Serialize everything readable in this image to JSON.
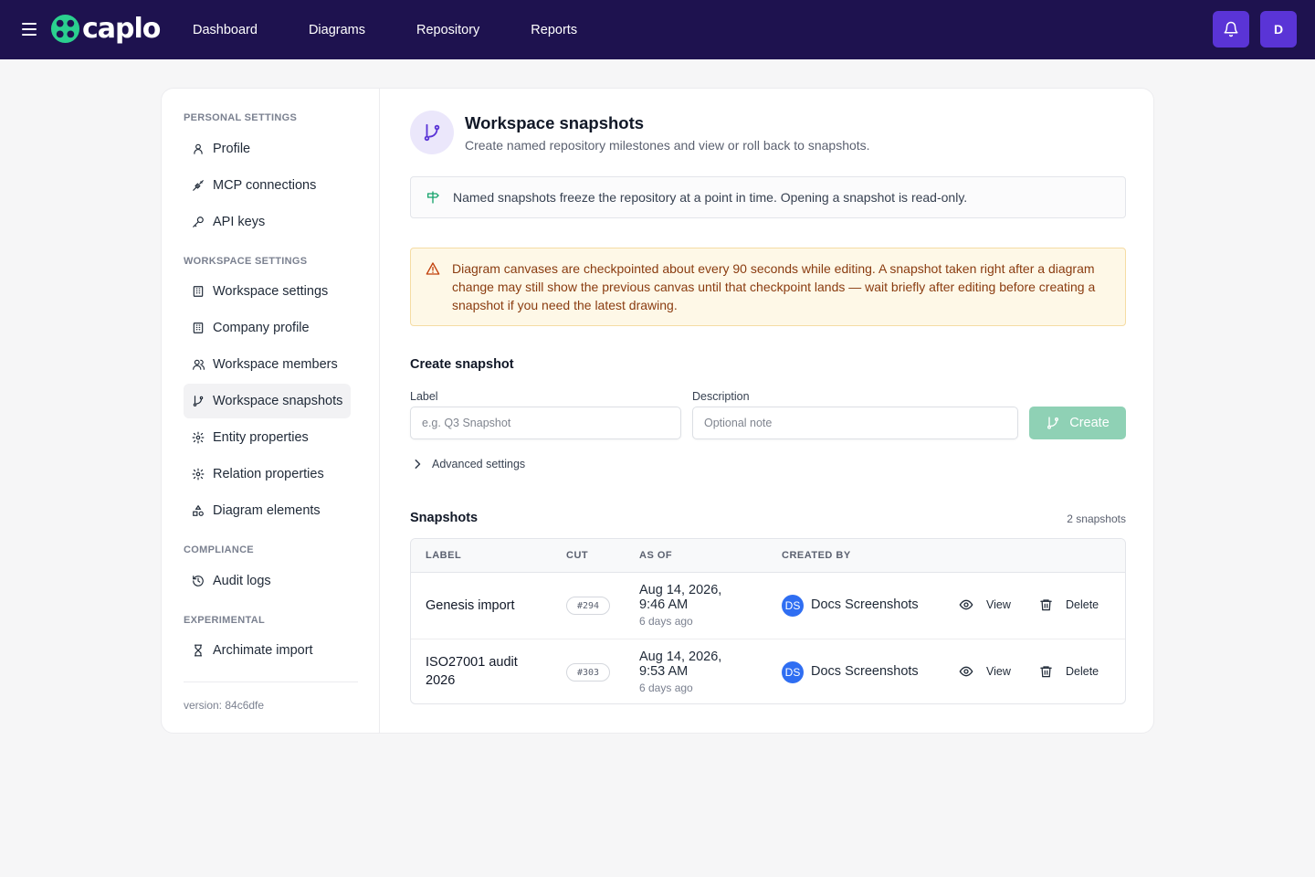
{
  "app": {
    "logo_text": "caplo",
    "nav": [
      "Dashboard",
      "Diagrams",
      "Repository",
      "Reports"
    ],
    "avatar_initial": "D",
    "brand_color": "#1e124f",
    "accent_color": "#5a34d6"
  },
  "sidebar": {
    "sections": {
      "personal": "PERSONAL SETTINGS",
      "workspace": "WORKSPACE SETTINGS",
      "compliance": "COMPLIANCE",
      "experimental": "EXPERIMENTAL"
    },
    "items": [
      {
        "label": "Profile",
        "icon": "user-icon"
      },
      {
        "label": "MCP connections",
        "icon": "plug-icon"
      },
      {
        "label": "API keys",
        "icon": "key-icon"
      },
      {
        "label": "Workspace settings",
        "icon": "building-icon"
      },
      {
        "label": "Company profile",
        "icon": "building-icon"
      },
      {
        "label": "Workspace members",
        "icon": "users-icon"
      },
      {
        "label": "Workspace snapshots",
        "icon": "git-branch-icon",
        "active": true
      },
      {
        "label": "Entity properties",
        "icon": "gear-icon"
      },
      {
        "label": "Relation properties",
        "icon": "gear-icon"
      },
      {
        "label": "Diagram elements",
        "icon": "shapes-icon"
      },
      {
        "label": "Audit logs",
        "icon": "history-icon"
      },
      {
        "label": "Archimate import",
        "icon": "hourglass-icon"
      }
    ],
    "version": "version: 84c6dfe"
  },
  "header": {
    "title": "Workspace snapshots",
    "subtitle": "Create named repository milestones and view or roll back to snapshots."
  },
  "info": "Named snapshots freeze the repository at a point in time. Opening a snapshot is read-only.",
  "warning": "Diagram canvases are checkpointed about every 90 seconds while editing. A snapshot taken right after a diagram change may still show the previous canvas until that checkpoint lands — wait briefly after editing before creating a snapshot if you need the latest drawing.",
  "create": {
    "title": "Create snapshot",
    "label_label": "Label",
    "label_placeholder": "e.g. Q3 Snapshot",
    "description_label": "Description",
    "description_placeholder": "Optional note",
    "button": "Create",
    "advanced": "Advanced settings"
  },
  "snapshots": {
    "title": "Snapshots",
    "count": "2 snapshots",
    "columns": [
      "LABEL",
      "CUT",
      "AS OF",
      "CREATED BY"
    ],
    "rows": [
      {
        "label": "Genesis import",
        "cut": "#294",
        "as_of": "Aug 14, 2026, 9:46 AM",
        "relative": "6 days ago",
        "creator_initials": "DS",
        "creator": "Docs Screenshots",
        "view": "View",
        "delete": "Delete"
      },
      {
        "label": "ISO27001 audit 2026",
        "cut": "#303",
        "as_of": "Aug 14, 2026, 9:53 AM",
        "relative": "6 days ago",
        "creator_initials": "DS",
        "creator": "Docs Screenshots",
        "view": "View",
        "delete": "Delete"
      }
    ]
  }
}
